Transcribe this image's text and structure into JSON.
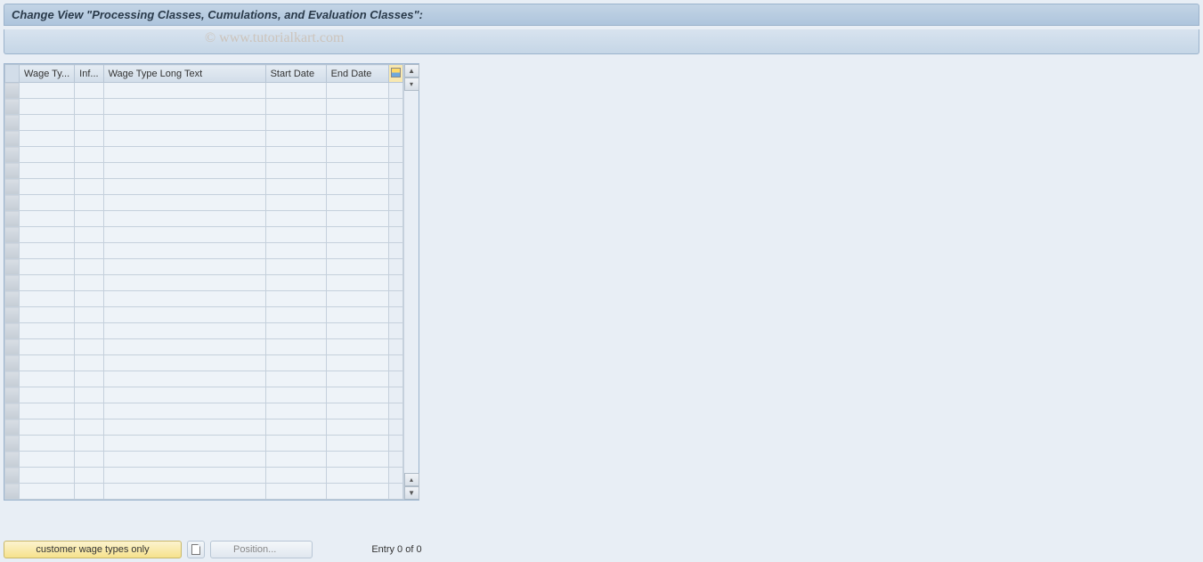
{
  "title": "Change View \"Processing Classes, Cumulations, and Evaluation Classes\":",
  "watermark": "© www.tutorialkart.com",
  "table": {
    "headers": {
      "wage_ty": "Wage Ty...",
      "inf": "Inf...",
      "long_text": "Wage Type Long Text",
      "start_date": "Start Date",
      "end_date": "End Date"
    },
    "row_count": 26
  },
  "bottom": {
    "customer_btn": "customer wage types only",
    "position_btn": "Position...",
    "entry_label": "Entry 0 of 0"
  }
}
